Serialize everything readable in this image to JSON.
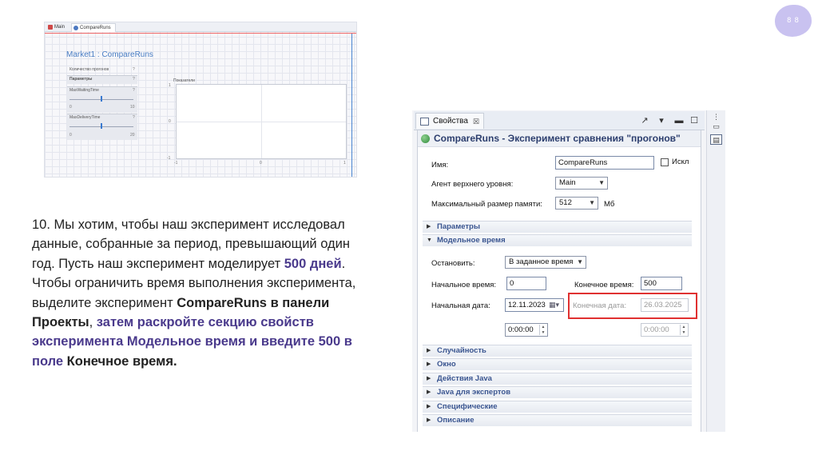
{
  "page_number": "8 8",
  "screenshot1": {
    "tabs": [
      "Main",
      "CompareRuns"
    ],
    "title": "Market1 : CompareRuns",
    "runs_label": "Количество прогонов",
    "runs_q": "?",
    "params_label": "Параметры",
    "params_q": "?",
    "param1": {
      "name": "MaxWaitingTime",
      "q": "?",
      "min": "0",
      "max": "10"
    },
    "param2": {
      "name": "MaxDeliveryTime",
      "q": "?",
      "min": "0",
      "max": "20"
    },
    "chart_title": "Показатели",
    "y_ticks": [
      "1",
      "0",
      "-1"
    ],
    "x_ticks": [
      "-1",
      "0",
      "1"
    ]
  },
  "instruction": {
    "p1": "10. Мы хотим, чтобы наш эксперимент исследовал данные, собранные за период, превышающий один год. Пусть наш эксперимент моделирует ",
    "days": "500 дней",
    "p2": ". Чтобы ограничить время выполнения эксперимента, выделите эксперимент ",
    "b1": "CompareRuns в панели Проекты",
    "p3": ", ",
    "bp1": "затем раскройте секцию свойств эксперимента Модельное время и введите 500 в поле ",
    "b2": "Конечное время."
  },
  "panel": {
    "tab_label": "Свойства",
    "tab_close": "☒",
    "title": "CompareRuns - Эксперимент сравнения \"прогонов\"",
    "name_label": "Имя:",
    "name_value": "CompareRuns",
    "exclude_label": "Искл",
    "agent_label": "Агент верхнего уровня:",
    "agent_value": "Main",
    "memory_label": "Максимальный размер памяти:",
    "memory_value": "512",
    "memory_unit": "Мб",
    "sections_top": [
      "Параметры",
      "Модельное время"
    ],
    "stop_label": "Остановить:",
    "stop_value": "В заданное время",
    "start_time_label": "Начальное время:",
    "start_time_value": "0",
    "end_time_label": "Конечное время:",
    "end_time_value": "500",
    "start_date_label": "Начальная дата:",
    "start_date_value": "12.11.2023",
    "end_date_label": "Конечная дата:",
    "end_date_value": "26.03.2025",
    "start_clock": "0:00:00",
    "end_clock": "0:00:00",
    "sections_bottom": [
      "Случайность",
      "Окно",
      "Действия Java",
      "Java для экспертов",
      "Специфические",
      "Описание"
    ]
  }
}
